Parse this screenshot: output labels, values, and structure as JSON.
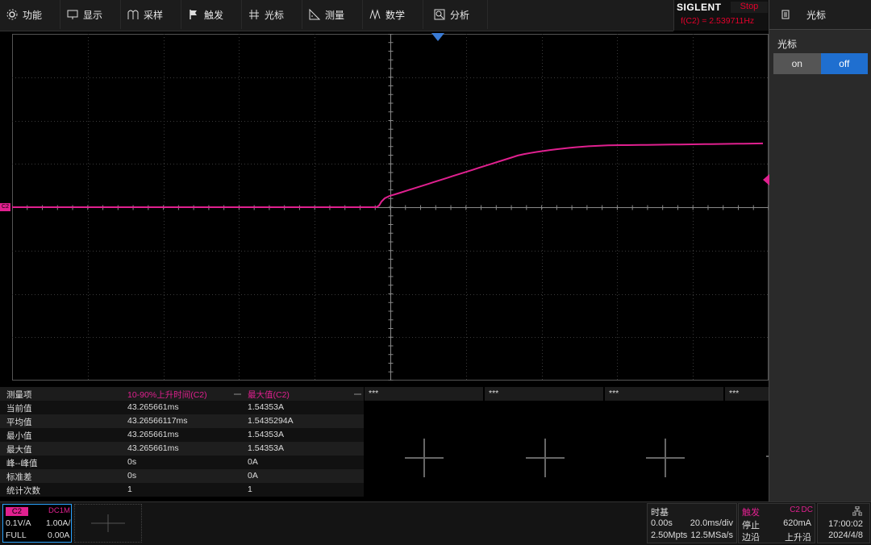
{
  "menu": [
    {
      "label": "功能",
      "icon": "gear-icon"
    },
    {
      "label": "显示",
      "icon": "monitor-icon"
    },
    {
      "label": "采样",
      "icon": "sampling-icon"
    },
    {
      "label": "触发",
      "icon": "trigger-flag-icon"
    },
    {
      "label": "光标",
      "icon": "cursor-icon"
    },
    {
      "label": "测量",
      "icon": "ruler-icon"
    },
    {
      "label": "数学",
      "icon": "math-icon"
    },
    {
      "label": "分析",
      "icon": "analysis-icon"
    }
  ],
  "brand": {
    "logo": "SIGLENT",
    "run_state": "Stop",
    "frequency": "f(C2) = 2.539711Hz",
    "run_color": "#e4002b"
  },
  "right_panel": {
    "title": "光标",
    "cursor_label": "光标",
    "on_label": "on",
    "off_label": "off",
    "active": "off"
  },
  "channel_marker": "C2",
  "trace_color": "#e0208f",
  "measure": {
    "headers": [
      "测量项",
      "10-90%上升时间(C2)",
      "最大值(C2)"
    ],
    "rows": [
      {
        "label": "当前值",
        "v1": "43.265661ms",
        "v2": "1.54353A"
      },
      {
        "label": "平均值",
        "v1": "43.26566117ms",
        "v2": "1.5435294A"
      },
      {
        "label": "最小值",
        "v1": "43.265661ms",
        "v2": "1.54353A"
      },
      {
        "label": "最大值",
        "v1": "43.265661ms",
        "v2": "1.54353A"
      },
      {
        "label": "峰--峰值",
        "v1": "0s",
        "v2": "0A"
      },
      {
        "label": "标准差",
        "v1": "0s",
        "v2": "0A"
      },
      {
        "label": "统计次数",
        "v1": "1",
        "v2": "1"
      }
    ],
    "empty_slots": [
      "***",
      "***",
      "***",
      "***"
    ]
  },
  "channel": {
    "name": "C2",
    "coupling": "DC1M",
    "scale": "0.1V/A",
    "offset": "1.00A/",
    "bw": "FULL",
    "offset2": "0.00A"
  },
  "timebase": {
    "title": "时基",
    "delay": "0.00s",
    "scale": "20.0ms/div",
    "points": "2.50Mpts",
    "rate": "12.5MSa/s"
  },
  "trigger": {
    "title": "触发",
    "source": "C2",
    "coupling": "DC",
    "mode": "停止",
    "level": "620mA",
    "type": "边沿",
    "slope": "上升沿"
  },
  "clock": {
    "time": "17:00:02",
    "date": "2024/4/8"
  }
}
